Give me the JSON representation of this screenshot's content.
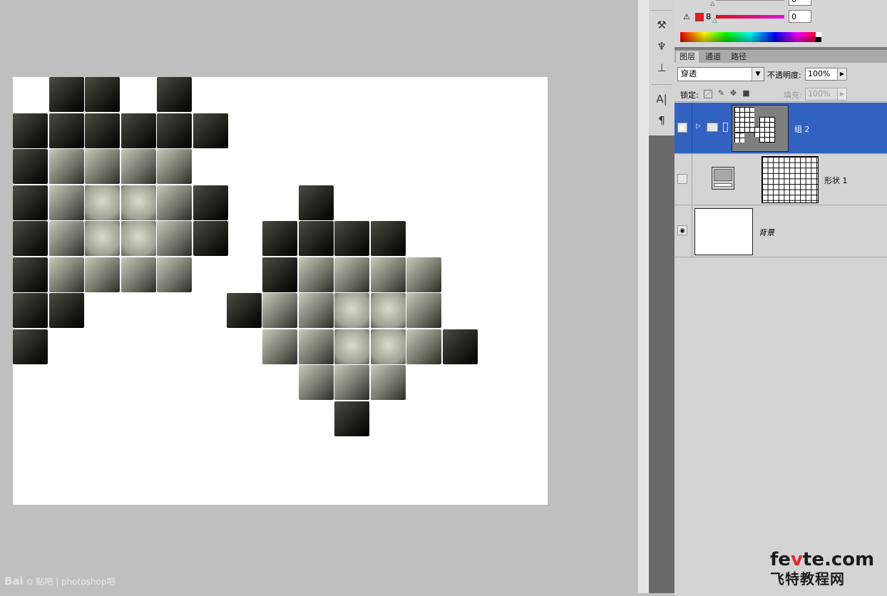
{
  "color_panel": {
    "b_channel_label": "B",
    "top_value": "0",
    "b_value": "0",
    "swatch_color": "#e62020"
  },
  "layers_panel": {
    "tabs": [
      {
        "label": "图层",
        "active": true
      },
      {
        "label": "通道",
        "active": false
      },
      {
        "label": "路径",
        "active": false
      }
    ],
    "blend_mode": "穿透",
    "opacity_label": "不透明度:",
    "opacity_value": "100%",
    "lock_label": "锁定:",
    "fill_label": "填充:",
    "fill_value": "100%",
    "layers": [
      {
        "name": "组 2",
        "type": "group",
        "visible": true,
        "selected": true
      },
      {
        "name": "形状 1",
        "type": "shape",
        "visible": false,
        "selected": false
      },
      {
        "name": "背景",
        "type": "background",
        "visible": true,
        "selected": false
      }
    ]
  },
  "dock": {
    "icons": [
      "brush-presets-icon",
      "clone-source-icon",
      "tool-presets-icon",
      "character-icon",
      "paragraph-icon"
    ]
  },
  "watermark": {
    "brand": "Bai",
    "text": "贴吧 | photoshop吧"
  },
  "logo": {
    "line1_a": "fe",
    "line1_v": "v",
    "line1_b": "te.com",
    "line2": "飞特教程网"
  }
}
